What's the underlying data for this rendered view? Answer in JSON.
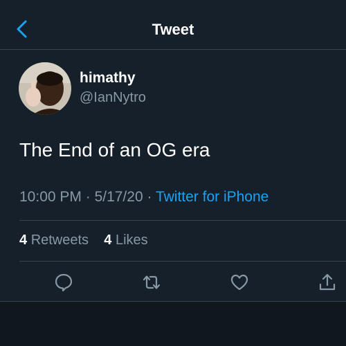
{
  "header": {
    "title": "Tweet",
    "back_icon": "chevron-left-icon"
  },
  "tweet": {
    "author": {
      "display_name": "himathy",
      "handle": "@IanNytro"
    },
    "text": "The End of an OG era",
    "time": "10:00 PM",
    "date": "5/17/20",
    "separator": "·",
    "source": "Twitter for iPhone"
  },
  "stats": {
    "retweets_count": "4",
    "retweets_label": "Retweets",
    "likes_count": "4",
    "likes_label": "Likes"
  },
  "actions": [
    {
      "name": "reply",
      "icon": "speech-bubble-icon"
    },
    {
      "name": "retweet",
      "icon": "retweet-arrows-icon"
    },
    {
      "name": "like",
      "icon": "heart-icon"
    },
    {
      "name": "share",
      "icon": "share-up-arrow-icon"
    }
  ],
  "colors": {
    "background": "#15202b",
    "accent": "#1da1f2",
    "secondary_text": "#8899a6",
    "divider": "#38444d"
  }
}
